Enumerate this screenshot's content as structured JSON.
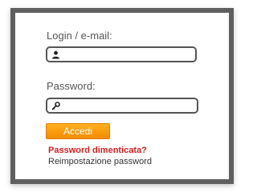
{
  "login_form": {
    "login_label": "Login / e-mail:",
    "login_value": "",
    "password_label": "Password:",
    "password_value": "",
    "submit_label": "Accedi",
    "forgot_password_label": "Password dimenticata?",
    "reset_password_label": "Reimpostazione password"
  },
  "icons": {
    "login_field_icon": "user-icon",
    "password_field_icon": "key-icon"
  },
  "colors": {
    "panel_border": "#5f5f5f",
    "button_top": "#ffb020",
    "button_bottom": "#f28a00",
    "forgot_link": "#d21f1f"
  }
}
